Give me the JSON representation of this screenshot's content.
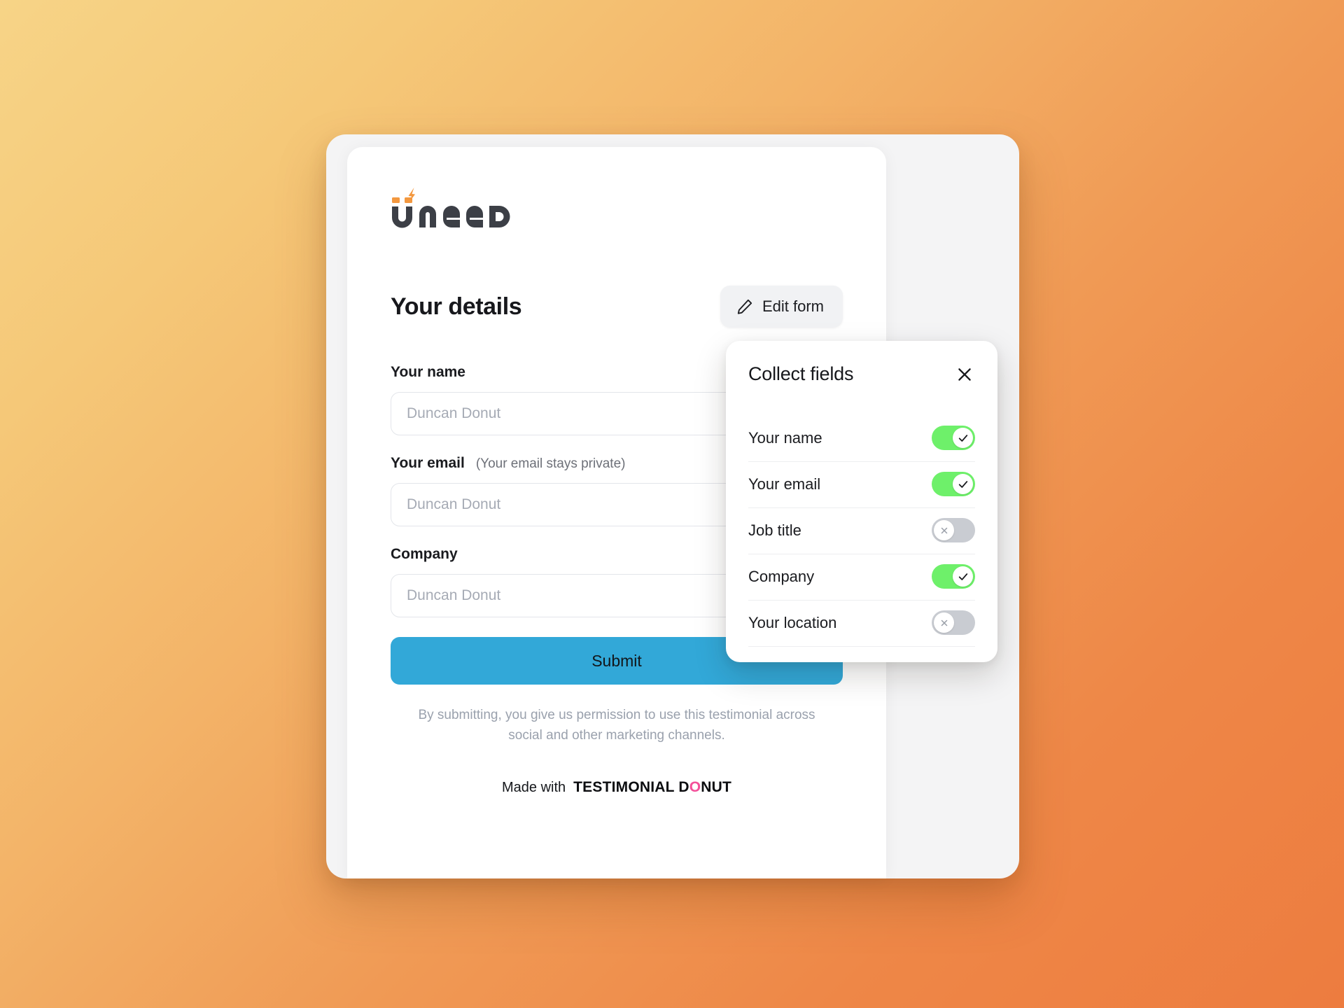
{
  "brand": {
    "logo_text": "UNEED",
    "accent_color": "#f3983f"
  },
  "form": {
    "title": "Your details",
    "edit_button_label": "Edit form",
    "fields": [
      {
        "label": "Your name",
        "hint": "",
        "placeholder": "Duncan Donut"
      },
      {
        "label": "Your email",
        "hint": "(Your email stays private)",
        "placeholder": "Duncan Donut"
      },
      {
        "label": "Company",
        "hint": "",
        "placeholder": "Duncan Donut"
      }
    ],
    "submit_label": "Submit",
    "submit_color": "#32a8d8",
    "disclaimer": "By submitting, you give us permission to use this testimonial across social and other marketing channels."
  },
  "footer": {
    "made_with_label": "Made with",
    "brand_part_1": "TESTIMONIAL D",
    "brand_highlight": "O",
    "brand_part_2": "NUT",
    "highlight_color": "#f4509a"
  },
  "popover": {
    "title": "Collect fields",
    "close_icon": "close-icon",
    "toggles": [
      {
        "label": "Your name",
        "state": "on"
      },
      {
        "label": "Your email",
        "state": "on"
      },
      {
        "label": "Job title",
        "state": "off"
      },
      {
        "label": "Company",
        "state": "on"
      },
      {
        "label": "Your location",
        "state": "off"
      }
    ],
    "on_color": "#6ef06a",
    "off_color": "#c9ccd2"
  }
}
